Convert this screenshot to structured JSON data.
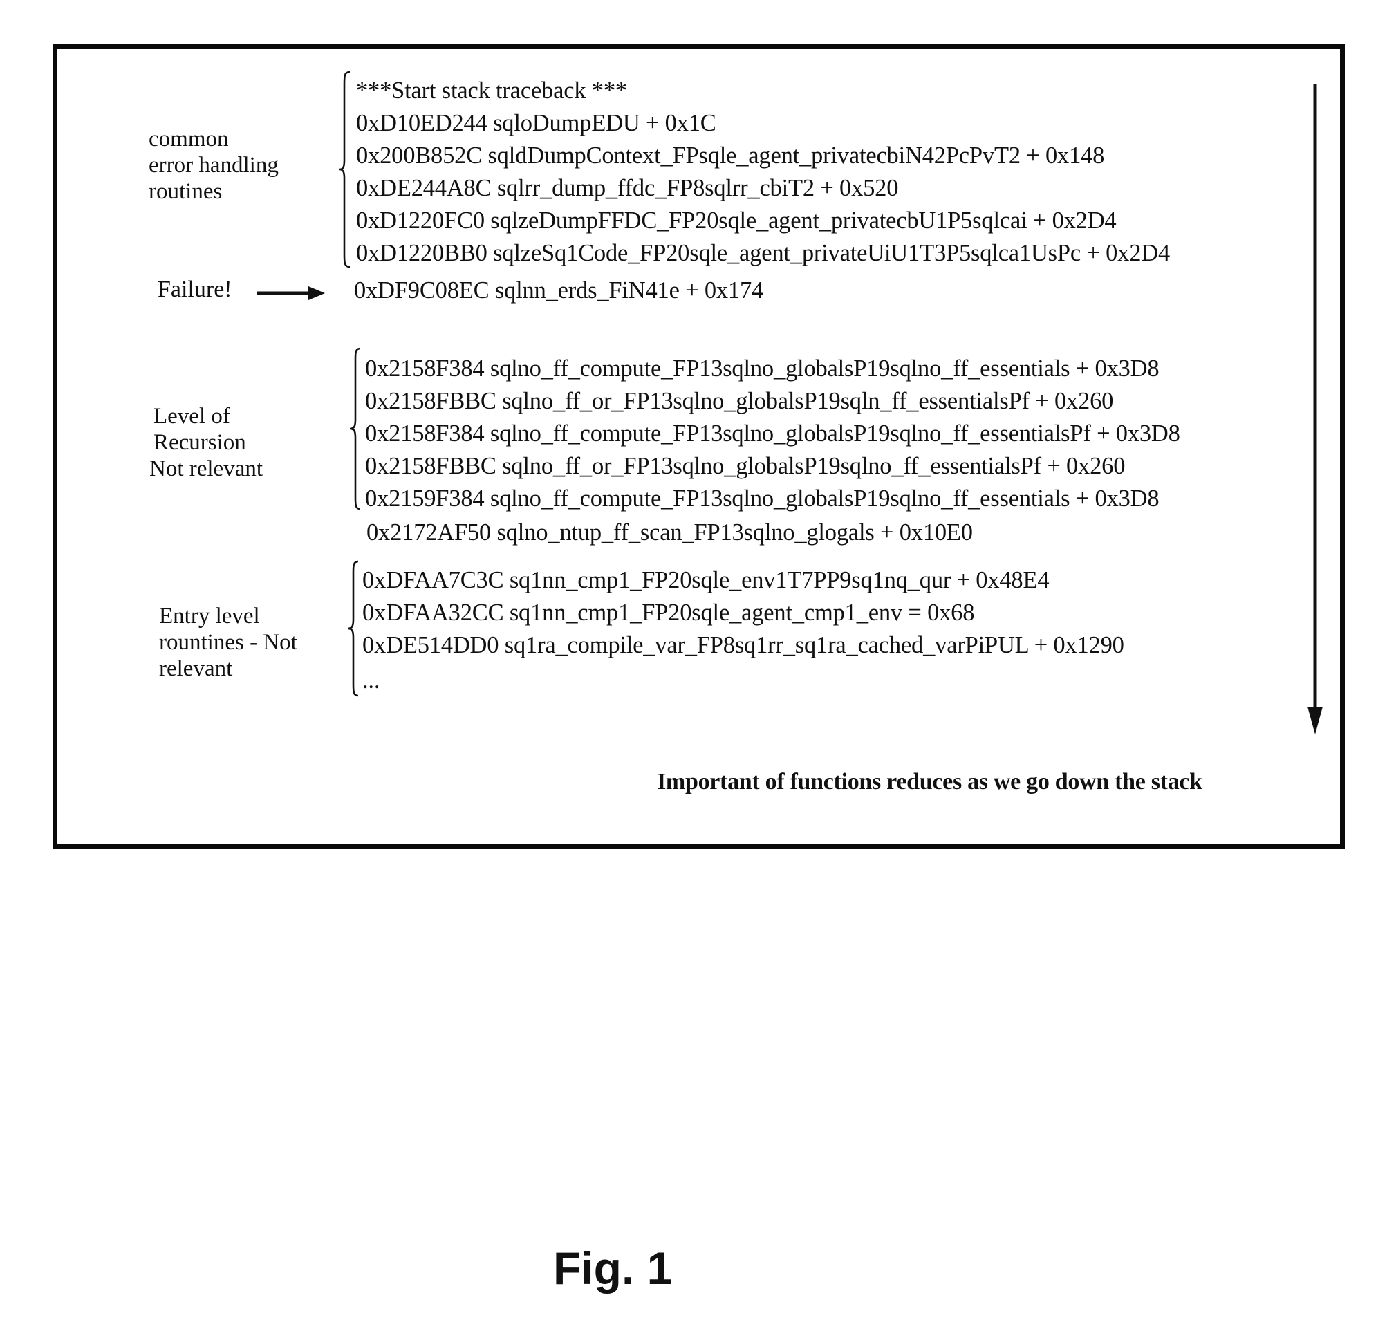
{
  "figure_title": "Fig. 1",
  "caption": "Important of functions reduces as we go down the stack",
  "groups": {
    "error_handling": {
      "label_lines": [
        "common",
        "error handling",
        "routines"
      ],
      "lines": [
        "***Start stack traceback ***",
        "0xD10ED244 sqloDumpEDU + 0x1C",
        "0x200B852C sqldDumpContext_FPsqle_agent_privatecbiN42PcPvT2 + 0x148",
        "0xDE244A8C sqlrr_dump_ffdc_FP8sqlrr_cbiT2 + 0x520",
        "0xD1220FC0 sqlzeDumpFFDC_FP20sqle_agent_privatecbU1P5sqlcai + 0x2D4",
        "0xD1220BB0 sqlzeSq1Code_FP20sqle_agent_privateUiU1T3P5sqlca1UsPc + 0x2D4"
      ]
    },
    "failure": {
      "label": "Failure!",
      "arrow_icon": "right-arrow",
      "line": "0xDF9C08EC sqlnn_erds_FiN41e + 0x174"
    },
    "recursion": {
      "label_lines": [
        "Level of",
        "Recursion",
        "Not relevant"
      ],
      "lines": [
        "0x2158F384 sqlno_ff_compute_FP13sqlno_globalsP19sqlno_ff_essentials + 0x3D8",
        "0x2158FBBC sqlno_ff_or_FP13sqlno_globalsP19sqln_ff_essentialsPf + 0x260",
        "0x2158F384 sqlno_ff_compute_FP13sqlno_globalsP19sqlno_ff_essentialsPf + 0x3D8",
        "0x2158FBBC sqlno_ff_or_FP13sqlno_globalsP19sqlno_ff_essentialsPf + 0x260",
        "0x2159F384 sqlno_ff_compute_FP13sqlno_globalsP19sqlno_ff_essentials + 0x3D8"
      ],
      "trailing_line": "0x2172AF50 sqlno_ntup_ff_scan_FP13sqlno_glogals + 0x10E0"
    },
    "entry": {
      "label_lines": [
        "Entry level",
        "rountines - Not",
        "relevant"
      ],
      "lines": [
        "0xDFAA7C3C sq1nn_cmp1_FP20sqle_env1T7PP9sq1nq_qur + 0x48E4",
        "0xDFAA32CC sq1nn_cmp1_FP20sqle_agent_cmp1_env = 0x68",
        "0xDE514DD0 sq1ra_compile_var_FP8sq1rr_sq1ra_cached_varPiPUL + 0x1290",
        "..."
      ]
    }
  },
  "side_arrow_icon": "down-arrow"
}
